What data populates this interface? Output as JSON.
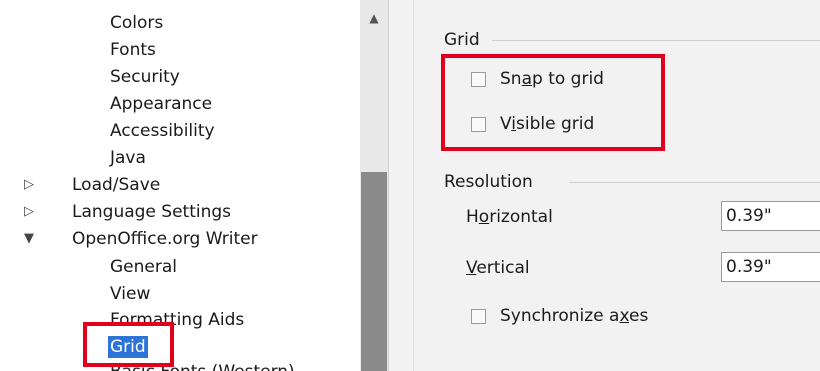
{
  "tree": {
    "items": [
      {
        "label": "Colors"
      },
      {
        "label": "Fonts"
      },
      {
        "label": "Security"
      },
      {
        "label": "Appearance"
      },
      {
        "label": "Accessibility"
      },
      {
        "label": "Java"
      },
      {
        "label": "Load/Save"
      },
      {
        "label": "Language Settings"
      },
      {
        "label": "OpenOffice.org Writer"
      },
      {
        "label": "General"
      },
      {
        "label": "View"
      },
      {
        "label": "Formatting Aids"
      },
      {
        "label": "Grid"
      },
      {
        "label": "Basic Fonts (Western)"
      }
    ]
  },
  "grid_section": {
    "title": "Grid",
    "snap": {
      "pre": "Sn",
      "accel": "a",
      "post": "p to grid",
      "checked": false
    },
    "visible": {
      "pre": "V",
      "accel": "i",
      "post": "sible grid",
      "checked": false
    }
  },
  "resolution_section": {
    "title": "Resolution",
    "horizontal": {
      "pre": "H",
      "accel": "o",
      "post": "rizontal",
      "value": "0.39\""
    },
    "vertical": {
      "pre": "",
      "accel": "V",
      "post": "ertical",
      "value": "0.39\""
    },
    "sync": {
      "pre": "Synchronize a",
      "accel": "x",
      "post": "es",
      "checked": false
    }
  },
  "colors": {
    "highlight": "#e0001b",
    "selection": "#2d74d6"
  }
}
